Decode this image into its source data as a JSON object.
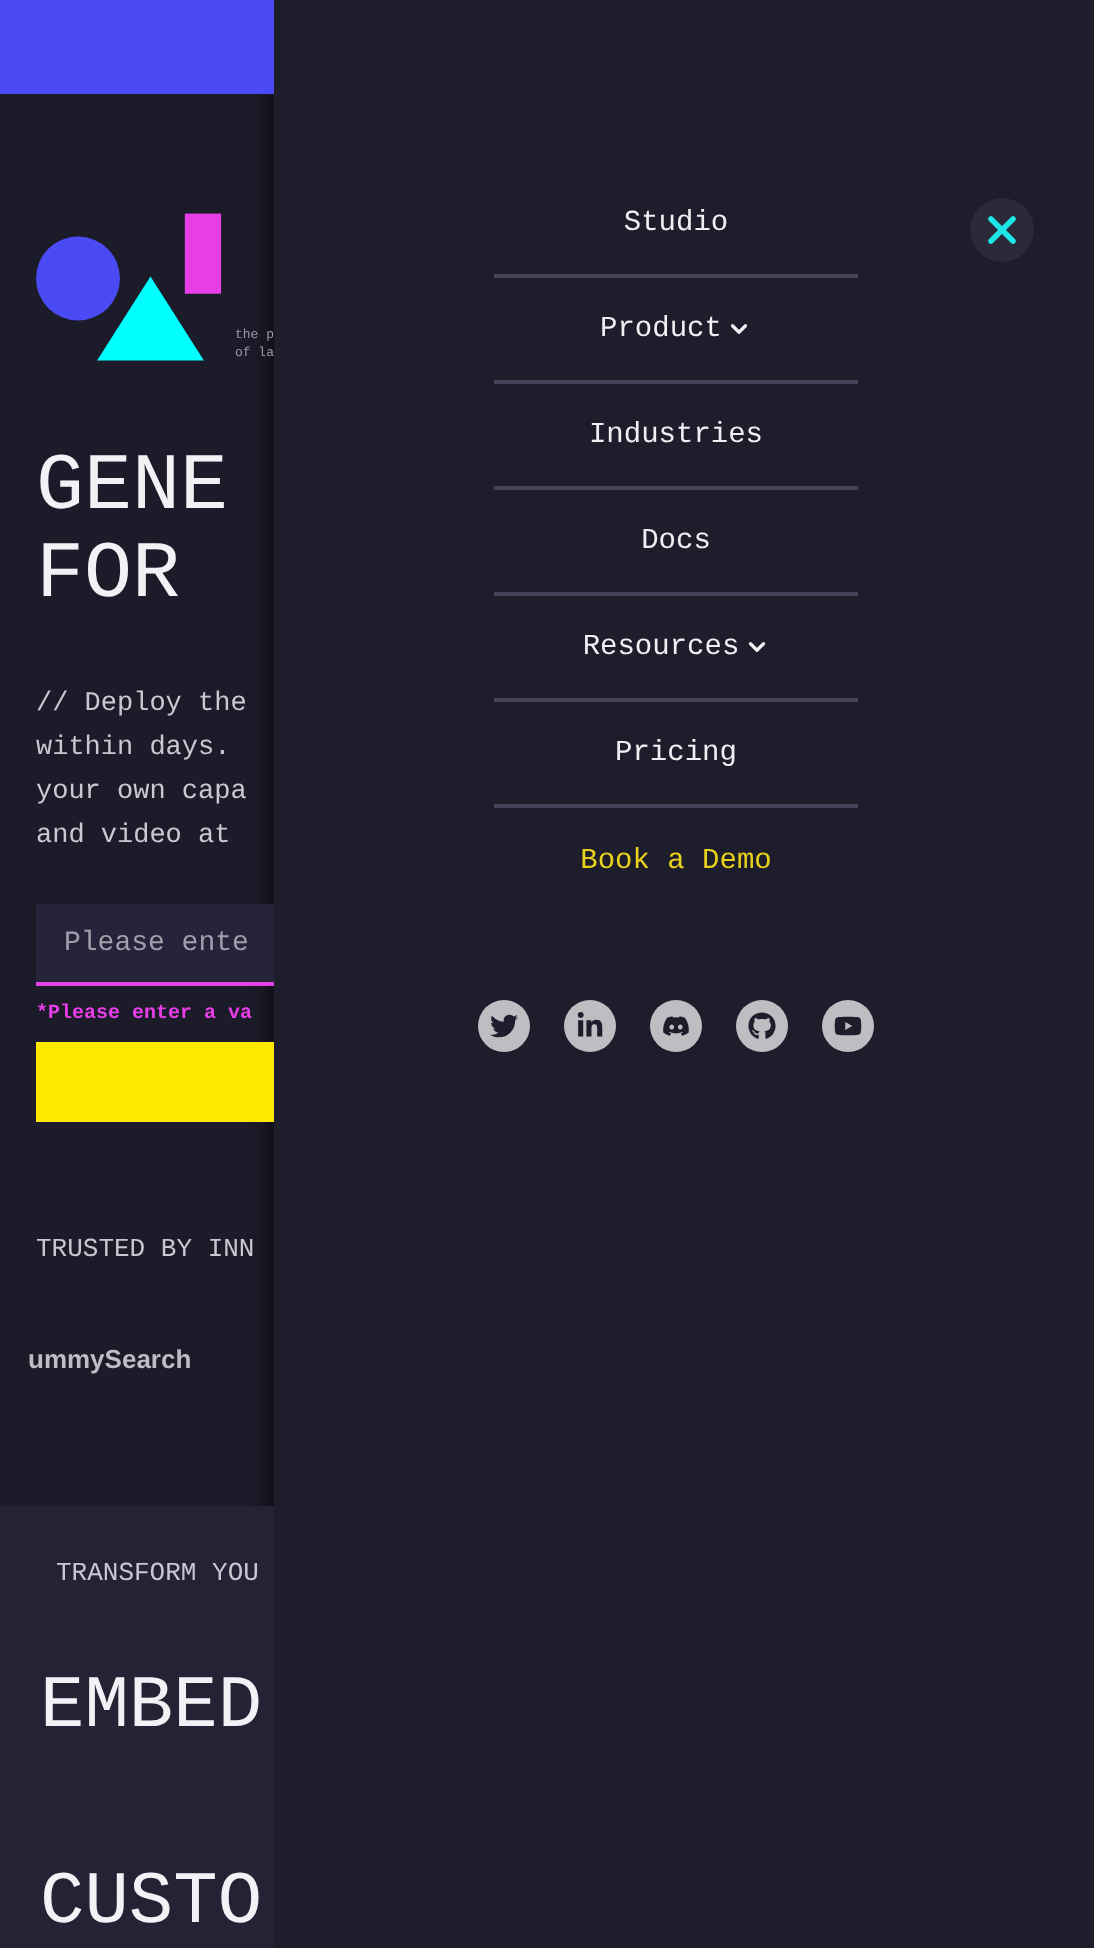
{
  "page_behind": {
    "logo_caption": [
      "the p",
      "of la"
    ],
    "headline": [
      "GENE",
      "FOR"
    ],
    "intro": [
      "// Deploy the",
      "within days.",
      "your own capa",
      "and video at"
    ],
    "email_field": {
      "placeholder": "Please ente"
    },
    "error": "*Please enter a va",
    "trusted_heading": "TRUSTED BY INN",
    "customer_logos": [
      "ummySearch"
    ],
    "section_heading": "TRANSFORM YOU",
    "features": [
      "EMBED",
      "CUSTO"
    ]
  },
  "menu": {
    "items": [
      {
        "label": "Studio",
        "kind": "link"
      },
      {
        "label": "Product",
        "kind": "dropdown"
      },
      {
        "label": "Industries",
        "kind": "link"
      },
      {
        "label": "Docs",
        "kind": "link"
      },
      {
        "label": "Resources",
        "kind": "dropdown"
      },
      {
        "label": "Pricing",
        "kind": "link"
      },
      {
        "label": "Book a Demo",
        "kind": "cta"
      }
    ]
  }
}
